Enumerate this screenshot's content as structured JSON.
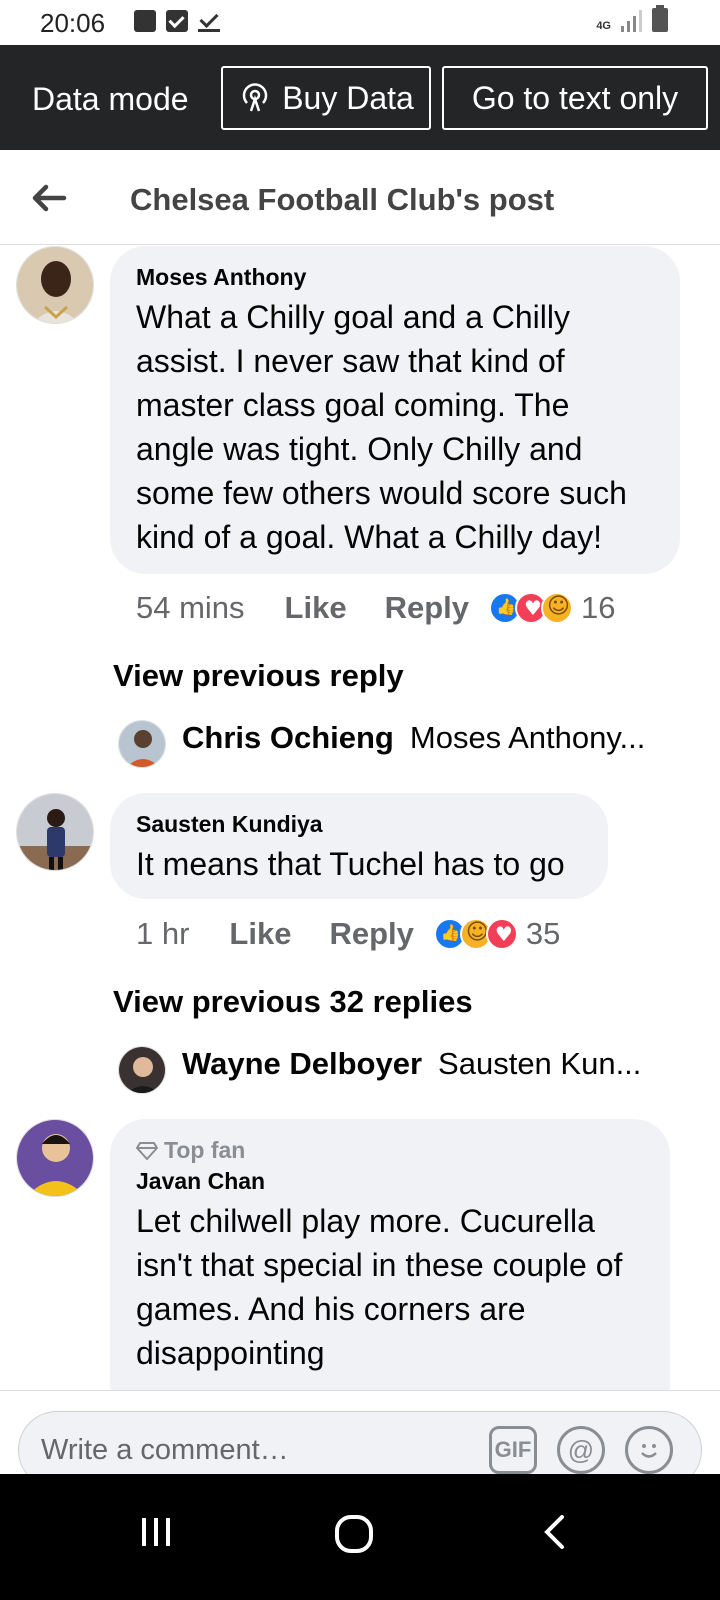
{
  "status": {
    "time": "20:06",
    "network": "4G"
  },
  "data_bar": {
    "label": "Data mode",
    "buy_label": "Buy Data",
    "text_only_label": "Go to text only"
  },
  "header": {
    "title": "Chelsea Football Club's post"
  },
  "comments": [
    {
      "name": "Moses Anthony",
      "text": "What a Chilly goal and a Chilly assist. I never saw that kind of master class goal coming. The angle was tight. Only  Chilly and some few others would score such kind of a goal. What a Chilly day!",
      "time": "54 mins",
      "like": "Like",
      "reply": "Reply",
      "reaction_count": "16",
      "view_previous": "View previous reply",
      "reply_preview": {
        "name": "Chris Ochieng",
        "text": "Moses Anthony..."
      }
    },
    {
      "name": "Sausten Kundiya",
      "text": "It means that Tuchel has to go",
      "time": "1 hr",
      "like": "Like",
      "reply": "Reply",
      "reaction_count": "35",
      "view_previous": "View previous 32 replies",
      "reply_preview": {
        "name": "Wayne Delboyer",
        "text": "Sausten Kun..."
      }
    },
    {
      "badge": "Top fan",
      "name": "Javan Chan",
      "text": "Let chilwell play more. Cucurella isn't that special in these couple of games. And his corners are disappointing"
    }
  ],
  "composer": {
    "placeholder": "Write a comment…",
    "gif_label": "GIF",
    "mention_label": "@"
  },
  "colors": {
    "dark_bar": "#242526",
    "bubble": "#f0f2f5",
    "like_blue": "#1877f2",
    "love_red": "#f33e58"
  }
}
